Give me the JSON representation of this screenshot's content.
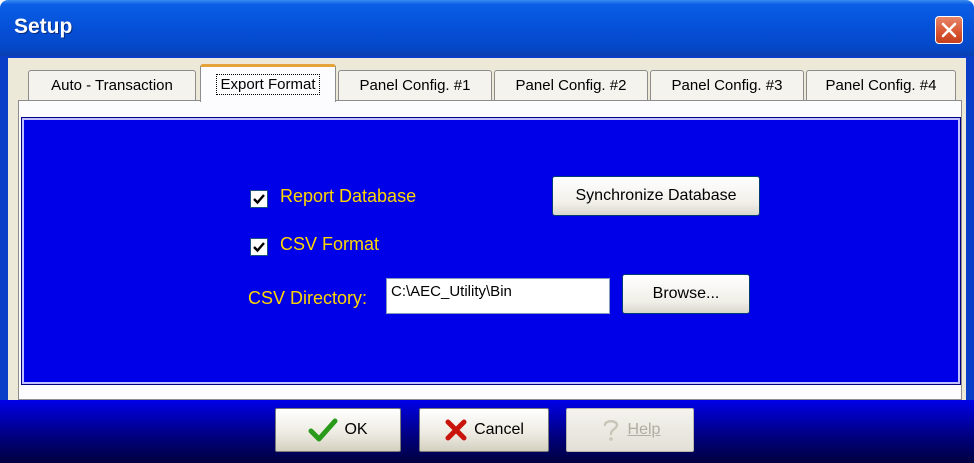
{
  "window": {
    "title": "Setup"
  },
  "tabs": [
    {
      "label": "Auto - Transaction",
      "active": false
    },
    {
      "label": "Export Format",
      "active": true
    },
    {
      "label": "Panel Config. #1",
      "active": false
    },
    {
      "label": "Panel Config. #2",
      "active": false
    },
    {
      "label": "Panel Config. #3",
      "active": false
    },
    {
      "label": "Panel Config. #4",
      "active": false
    }
  ],
  "export": {
    "report_database": {
      "label": "Report Database",
      "checked": true
    },
    "csv_format": {
      "label": "CSV Format",
      "checked": true
    },
    "csv_directory": {
      "label": "CSV Directory:",
      "value": "C:\\AEC_Utility\\Bin"
    },
    "synchronize_label": "Synchronize Database",
    "browse_label": "Browse..."
  },
  "footer": {
    "ok_label": "OK",
    "cancel_label": "Cancel",
    "help_label": "Help"
  },
  "colors": {
    "panel_bg": "#0000e8",
    "label_text": "#ffd700",
    "title_bar": "#0550d8"
  },
  "icons": {
    "close": "close-icon",
    "ok": "checkmark-icon",
    "cancel": "x-icon",
    "help": "question-mark-icon"
  }
}
